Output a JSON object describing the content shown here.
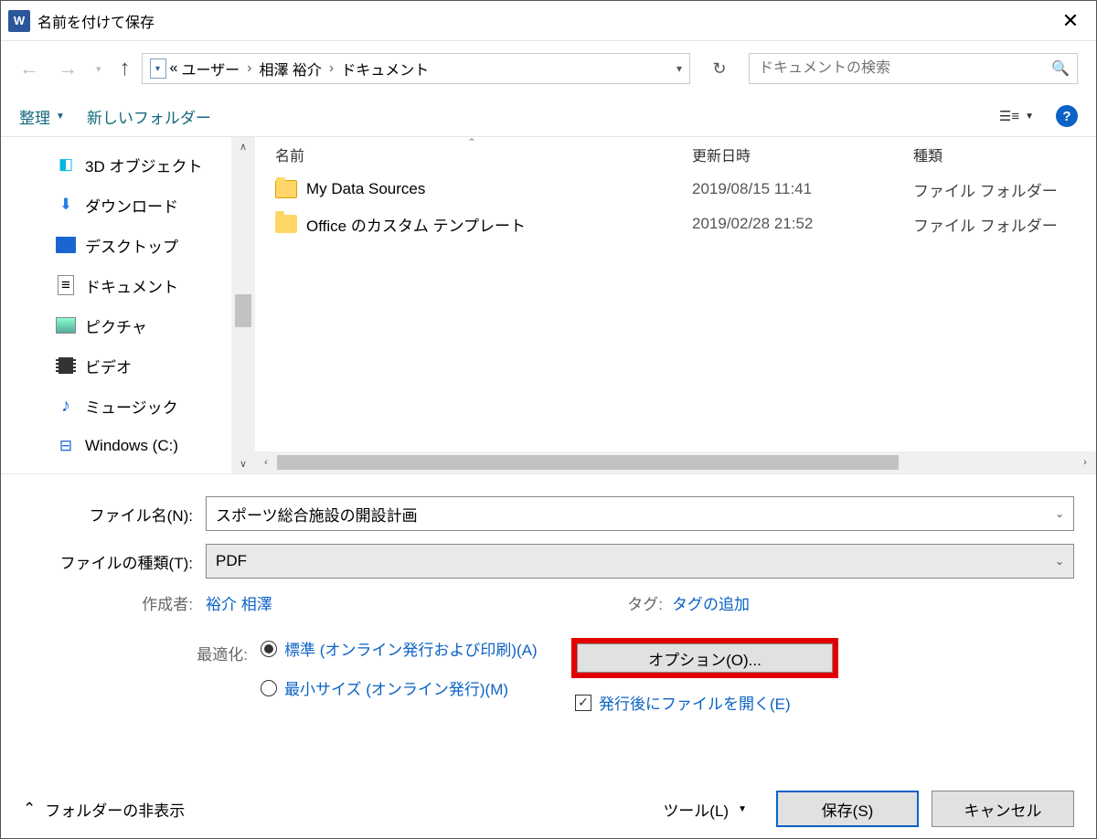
{
  "title": "名前を付けて保存",
  "breadcrumb": {
    "pre": "«",
    "p1": "ユーザー",
    "p2": "相澤 裕介",
    "p3": "ドキュメント"
  },
  "search": {
    "placeholder": "ドキュメントの検索"
  },
  "toolbar": {
    "organize": "整理",
    "newfolder": "新しいフォルダー"
  },
  "sidebar": {
    "items": [
      {
        "label": "3D オブジェクト"
      },
      {
        "label": "ダウンロード"
      },
      {
        "label": "デスクトップ"
      },
      {
        "label": "ドキュメント"
      },
      {
        "label": "ピクチャ"
      },
      {
        "label": "ビデオ"
      },
      {
        "label": "ミュージック"
      },
      {
        "label": "Windows (C:)"
      }
    ]
  },
  "columns": {
    "name": "名前",
    "date": "更新日時",
    "type": "種類"
  },
  "rows": [
    {
      "name": "My Data Sources",
      "date": "2019/08/15 11:41",
      "type": "ファイル フォルダー"
    },
    {
      "name": "Office のカスタム テンプレート",
      "date": "2019/02/28 21:52",
      "type": "ファイル フォルダー"
    }
  ],
  "form": {
    "filename_label": "ファイル名(N):",
    "filename_value": "スポーツ総合施設の開設計画",
    "filetype_label": "ファイルの種類(T):",
    "filetype_value": "PDF",
    "author_label": "作成者:",
    "author_value": "裕介 相澤",
    "tag_label": "タグ:",
    "tag_value": "タグの追加",
    "optimize_label": "最適化:",
    "radio1": "標準 (オンライン発行および印刷)(A)",
    "radio2": "最小サイズ (オンライン発行)(M)",
    "options_btn": "オプション(O)...",
    "openafter": "発行後にファイルを開く(E)"
  },
  "bottom": {
    "hidefolders": "フォルダーの非表示",
    "tools": "ツール(L)",
    "save": "保存(S)",
    "cancel": "キャンセル"
  }
}
